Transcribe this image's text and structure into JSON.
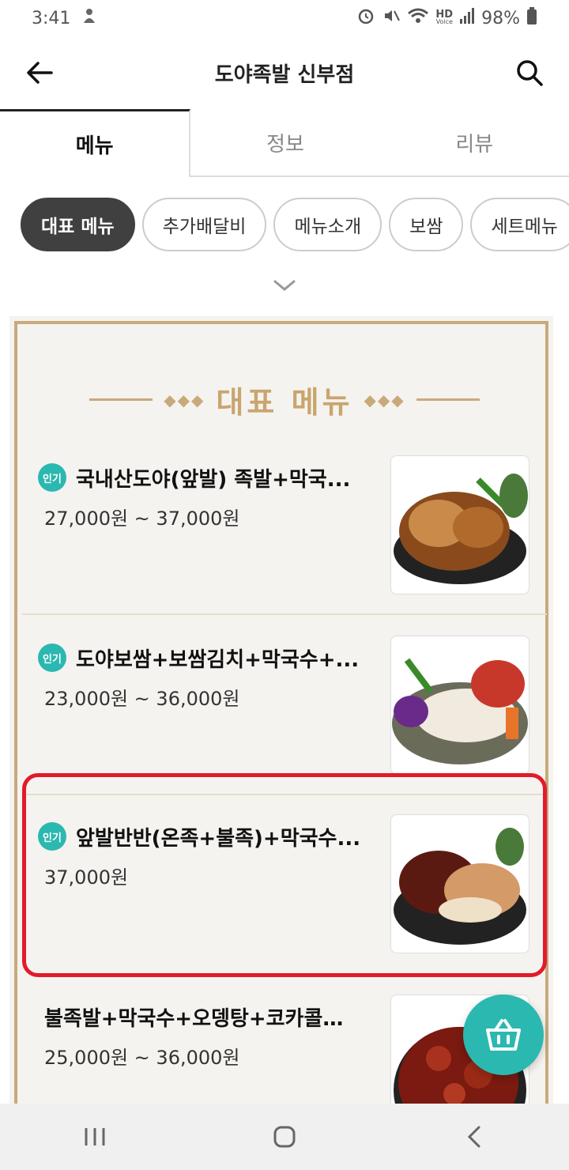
{
  "status": {
    "time": "3:41",
    "hd": "HD",
    "voice": "Voice",
    "battery": "98%"
  },
  "header": {
    "title": "도야족발 신부점"
  },
  "tabs": [
    {
      "label": "메뉴"
    },
    {
      "label": "정보"
    },
    {
      "label": "리뷰"
    }
  ],
  "chips": [
    {
      "label": "대표 메뉴"
    },
    {
      "label": "추가배달비"
    },
    {
      "label": "메뉴소개"
    },
    {
      "label": "보쌈"
    },
    {
      "label": "세트메뉴"
    }
  ],
  "section": {
    "title": "대표 메뉴"
  },
  "items": [
    {
      "badge": "인기",
      "name": "국내산도야(앞발) 족발+막국...",
      "price": "27,000원 ~ 37,000원",
      "image": "족발 image"
    },
    {
      "badge": "인기",
      "name": "도야보쌈+보쌈김치+막국수+...",
      "price": "23,000원 ~ 36,000원",
      "image": "보쌈 image"
    },
    {
      "badge": "인기",
      "name": "앞발반반(온족+불족)+막국수...",
      "price": "37,000원",
      "image": "반반족발 image"
    },
    {
      "badge": "",
      "name": "불족발+막국수+오뎅탕+코카콜라...",
      "price": "25,000원 ~ 36,000원",
      "image": "불족발 image"
    }
  ],
  "colors": {
    "accent": "#2bb8b0",
    "highlight": "#e21b2a",
    "gold": "#c9a97c",
    "chip_active": "#404040"
  }
}
